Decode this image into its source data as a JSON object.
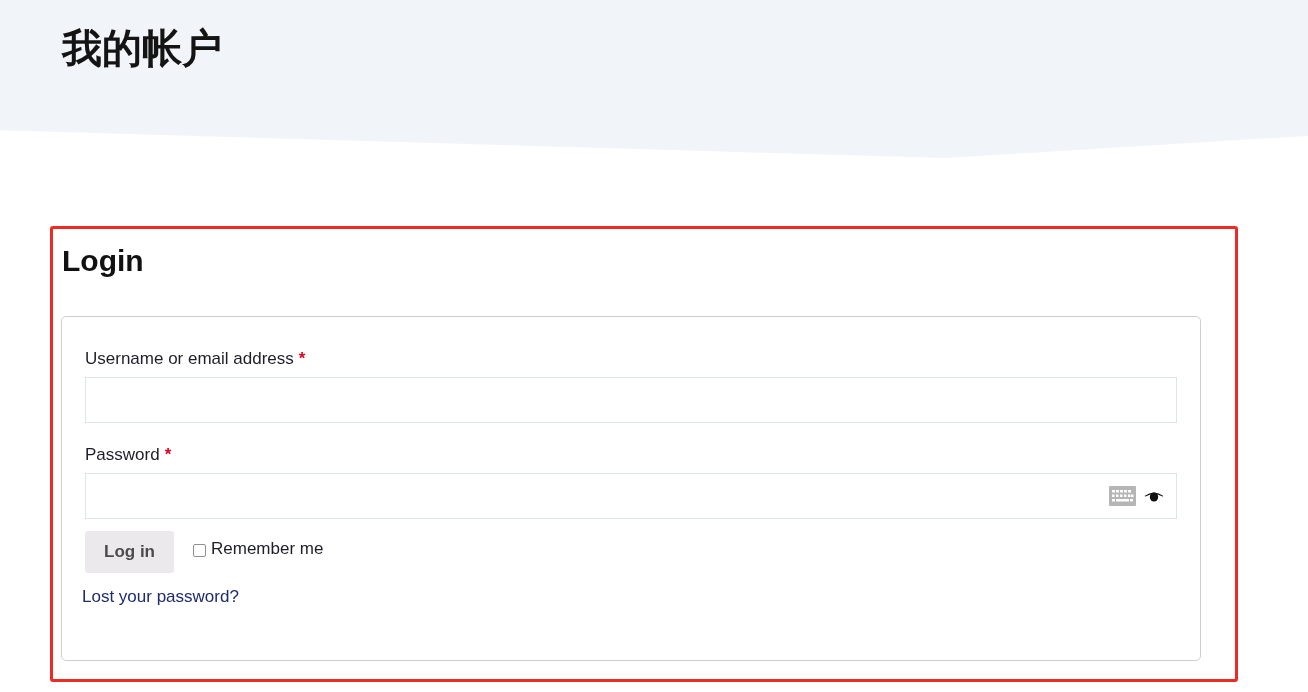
{
  "page_title": "我的帐户",
  "login": {
    "title": "Login",
    "fields": [
      {
        "kind": "text",
        "label": "Username or email address",
        "required_mark": "*"
      },
      {
        "kind": "password",
        "label": "Password",
        "required_mark": "*"
      }
    ],
    "submit": "Log in",
    "remember": {
      "label": "Remember me",
      "checked": false
    },
    "lost_password_link": "Lost your password?"
  }
}
